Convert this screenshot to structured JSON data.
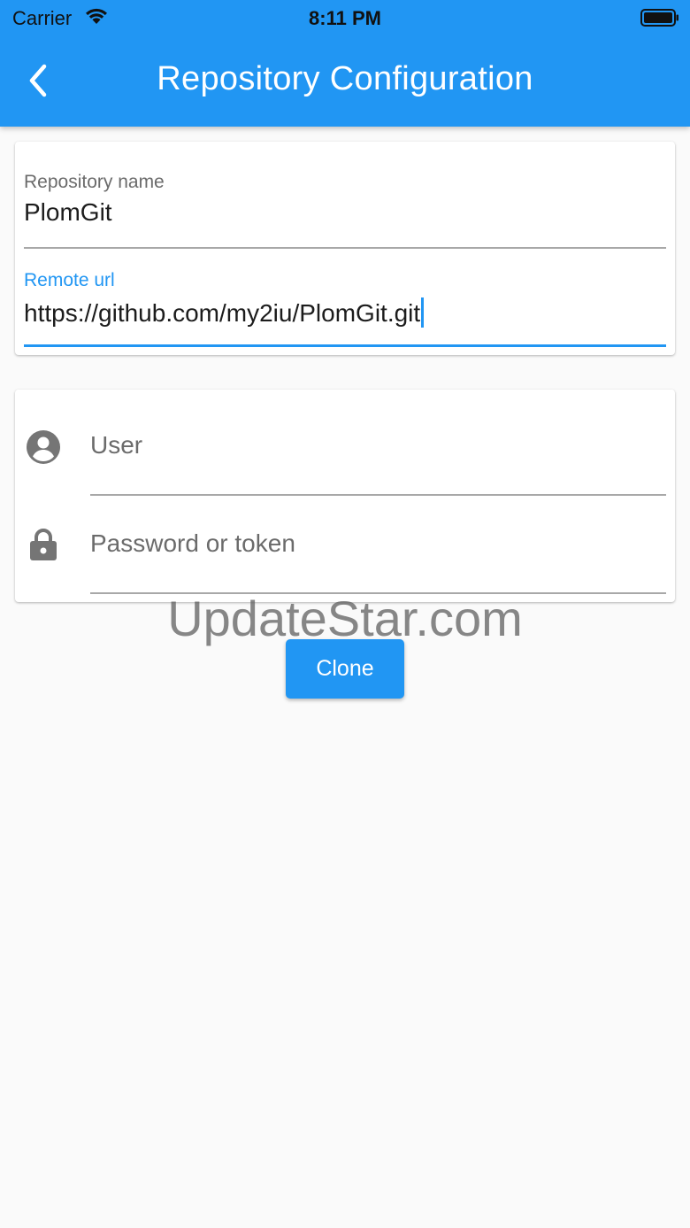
{
  "status_bar": {
    "carrier": "Carrier",
    "time": "8:11 PM",
    "wifi_icon": "wifi-icon",
    "battery_icon": "battery-icon"
  },
  "appbar": {
    "title": "Repository Configuration",
    "back_icon": "chevron-left-icon",
    "background_color": "#2196f3"
  },
  "repository_form": {
    "name_label": "Repository name",
    "name_value": "PlomGit",
    "url_label": "Remote url",
    "url_value": "https://github.com/my2iu/PlomGit.git"
  },
  "credentials_form": {
    "user_icon": "account-circle-icon",
    "user_placeholder": "User",
    "password_icon": "lock-icon",
    "password_placeholder": "Password or token"
  },
  "watermark": "UpdateStar.com",
  "actions": {
    "clone_label": "Clone"
  },
  "colors": {
    "accent": "#2196f3",
    "background": "#fafafa"
  }
}
